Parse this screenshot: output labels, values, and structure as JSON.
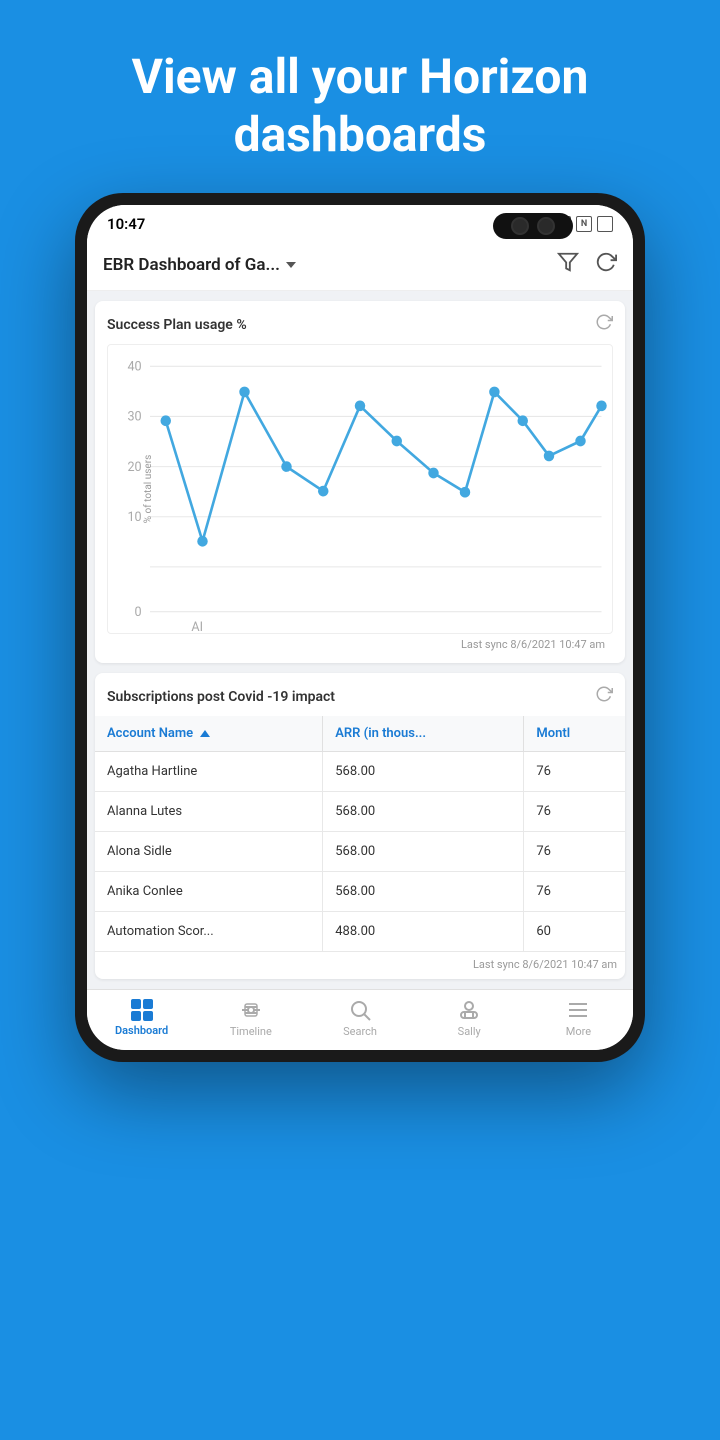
{
  "hero": {
    "line1": "View all your Horizon",
    "line2": "dashboards"
  },
  "status_bar": {
    "time": "10:47",
    "icons": [
      "phone",
      "N",
      "grid"
    ]
  },
  "app_header": {
    "title": "EBR Dashboard of Ga...",
    "filter_label": "filter",
    "refresh_label": "refresh"
  },
  "chart_card": {
    "title": "Success Plan usage %",
    "y_label": "% of total users",
    "x_label": "AI",
    "y_axis": [
      40,
      30,
      20,
      10,
      0
    ],
    "sync_text": "Last sync 8/6/2021 10:47 am"
  },
  "table_card": {
    "title": "Subscriptions post Covid -19 impact",
    "sync_text": "Last sync 8/6/2021 10:47 am",
    "columns": [
      "Account Name",
      "ARR (in thous...",
      "Montl"
    ],
    "rows": [
      {
        "name": "Agatha Hartline",
        "arr": "568.00",
        "month": "76"
      },
      {
        "name": "Alanna Lutes",
        "arr": "568.00",
        "month": "76"
      },
      {
        "name": "Alona Sidle",
        "arr": "568.00",
        "month": "76"
      },
      {
        "name": "Anika Conlee",
        "arr": "568.00",
        "month": "76"
      },
      {
        "name": "Automation Scor...",
        "arr": "488.00",
        "month": "60"
      }
    ]
  },
  "bottom_nav": {
    "items": [
      {
        "id": "dashboard",
        "label": "Dashboard",
        "active": true
      },
      {
        "id": "timeline",
        "label": "Timeline",
        "active": false
      },
      {
        "id": "search",
        "label": "Search",
        "active": false
      },
      {
        "id": "sally",
        "label": "Sally",
        "active": false
      },
      {
        "id": "more",
        "label": "More",
        "active": false
      }
    ]
  },
  "colors": {
    "brand_blue": "#1a8fe3",
    "chart_line": "#42a8e0",
    "nav_active": "#1a7bd4"
  }
}
